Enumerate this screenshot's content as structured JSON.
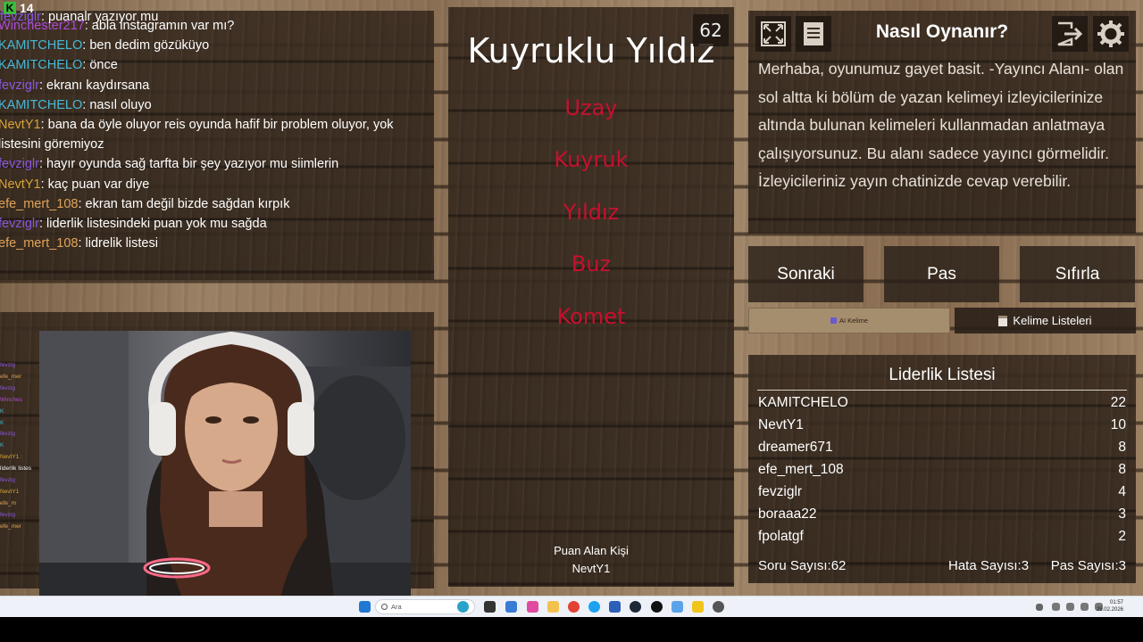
{
  "stream": {
    "viewer_count": "14"
  },
  "chat": {
    "top_partial": "puanalr yazıyor mu",
    "top_partial_user": "fevziglr",
    "messages": [
      {
        "user": "Winchester217",
        "color": "#b04ad8",
        "text": "abla instagramın var mı?"
      },
      {
        "user": "KAMITCHELO",
        "color": "#45b9d8",
        "text": "ben dedim gözüküyo"
      },
      {
        "user": "KAMITCHELO",
        "color": "#45b9d8",
        "text": "önce"
      },
      {
        "user": "fevziglr",
        "color": "#8a57e0",
        "text": "ekranı kaydırsana"
      },
      {
        "user": "KAMITCHELO",
        "color": "#45b9d8",
        "text": "nasıl oluyo"
      },
      {
        "user": "NevtY1",
        "color": "#d6a338",
        "text": "bana da öyle oluyor reis oyunda hafif bir problem oluyor, yok listesini göremiyoz"
      },
      {
        "user": "fevziglr",
        "color": "#8a57e0",
        "text": "hayır oyunda sağ tarfta bir şey yazıyor mu siimlerin"
      },
      {
        "user": "NevtY1",
        "color": "#d6a338",
        "text": "kaç puan var diye"
      },
      {
        "user": "efe_mert_108",
        "color": "#e0a458",
        "text": "ekran tam değil bizde sağdan kırpık"
      },
      {
        "user": "fevziglr",
        "color": "#8a57e0",
        "text": "liderlik listesindeki puan yok mu sağda"
      },
      {
        "user": "efe_mert_108",
        "color": "#e0a458",
        "text": "lidrelik listesi"
      }
    ]
  },
  "mini_chat": [
    {
      "text": "fevzig",
      "color": "#8a57e0"
    },
    {
      "text": "efe_mer",
      "color": "#e0a458"
    },
    {
      "text": "fevzig",
      "color": "#8a57e0"
    },
    {
      "text": "Winches",
      "color": "#b04ad8"
    },
    {
      "text": "K",
      "color": "#45b9d8"
    },
    {
      "text": "K",
      "color": "#45b9d8"
    },
    {
      "text": "fevzig",
      "color": "#8a57e0"
    },
    {
      "text": "K",
      "color": "#45b9d8"
    },
    {
      "text": "NevtY1 :",
      "color": "#d6a338"
    },
    {
      "text": "liderlik listes",
      "color": "#ffffff"
    },
    {
      "text": "fevzig",
      "color": "#8a57e0"
    },
    {
      "text": "NevtY1",
      "color": "#d6a338"
    },
    {
      "text": "efe_m",
      "color": "#e0a458"
    },
    {
      "text": "fevzig",
      "color": "#8a57e0"
    },
    {
      "text": "efe_mer",
      "color": "#e0a458"
    }
  ],
  "game": {
    "word": "Kuyruklu Yıldız",
    "timer": "62",
    "forbidden_words": [
      "Uzay",
      "Kuyruk",
      "Yıldız",
      "Buz",
      "Komet"
    ],
    "scorer_label": "Puan Alan Kişi",
    "scorer_name": "NevtY1"
  },
  "rules": {
    "title": "Nasıl Oynanır?",
    "text": "Merhaba, oyunumuz gayet basit. -Yayıncı Alanı- olan sol altta ki bölüm de yazan kelimeyi izleyicilerinize altında bulunan kelimeleri kullanmadan anlatmaya çalışıyorsunuz. Bu alanı sadece yayıncı görmelidir. İzleyicileriniz yayın chatinizde cevap verebilir."
  },
  "actions": {
    "next": "Sonraki",
    "pass": "Pas",
    "reset": "Sıfırla",
    "ai_word": "AI Kelime",
    "word_lists": "Kelime Listeleri"
  },
  "leaderboard": {
    "title": "Liderlik Listesi",
    "rows": [
      {
        "name": "KAMITCHELO",
        "score": "22"
      },
      {
        "name": "NevtY1",
        "score": "10"
      },
      {
        "name": "dreamer671",
        "score": "8"
      },
      {
        "name": "efe_mert_108",
        "score": "8"
      },
      {
        "name": "fevziglr",
        "score": "4"
      },
      {
        "name": "boraaa22",
        "score": "3"
      },
      {
        "name": "fpolatgf",
        "score": "2"
      }
    ],
    "question_count_label": "Soru Sayısı:",
    "question_count": "62",
    "error_count_label": "Hata Sayısı:",
    "error_count": "3",
    "pass_count_label": "Pas Sayısı:",
    "pass_count": "3"
  },
  "taskbar": {
    "search_placeholder": "Ara",
    "time": "01:57",
    "date": "25.02.2026"
  }
}
